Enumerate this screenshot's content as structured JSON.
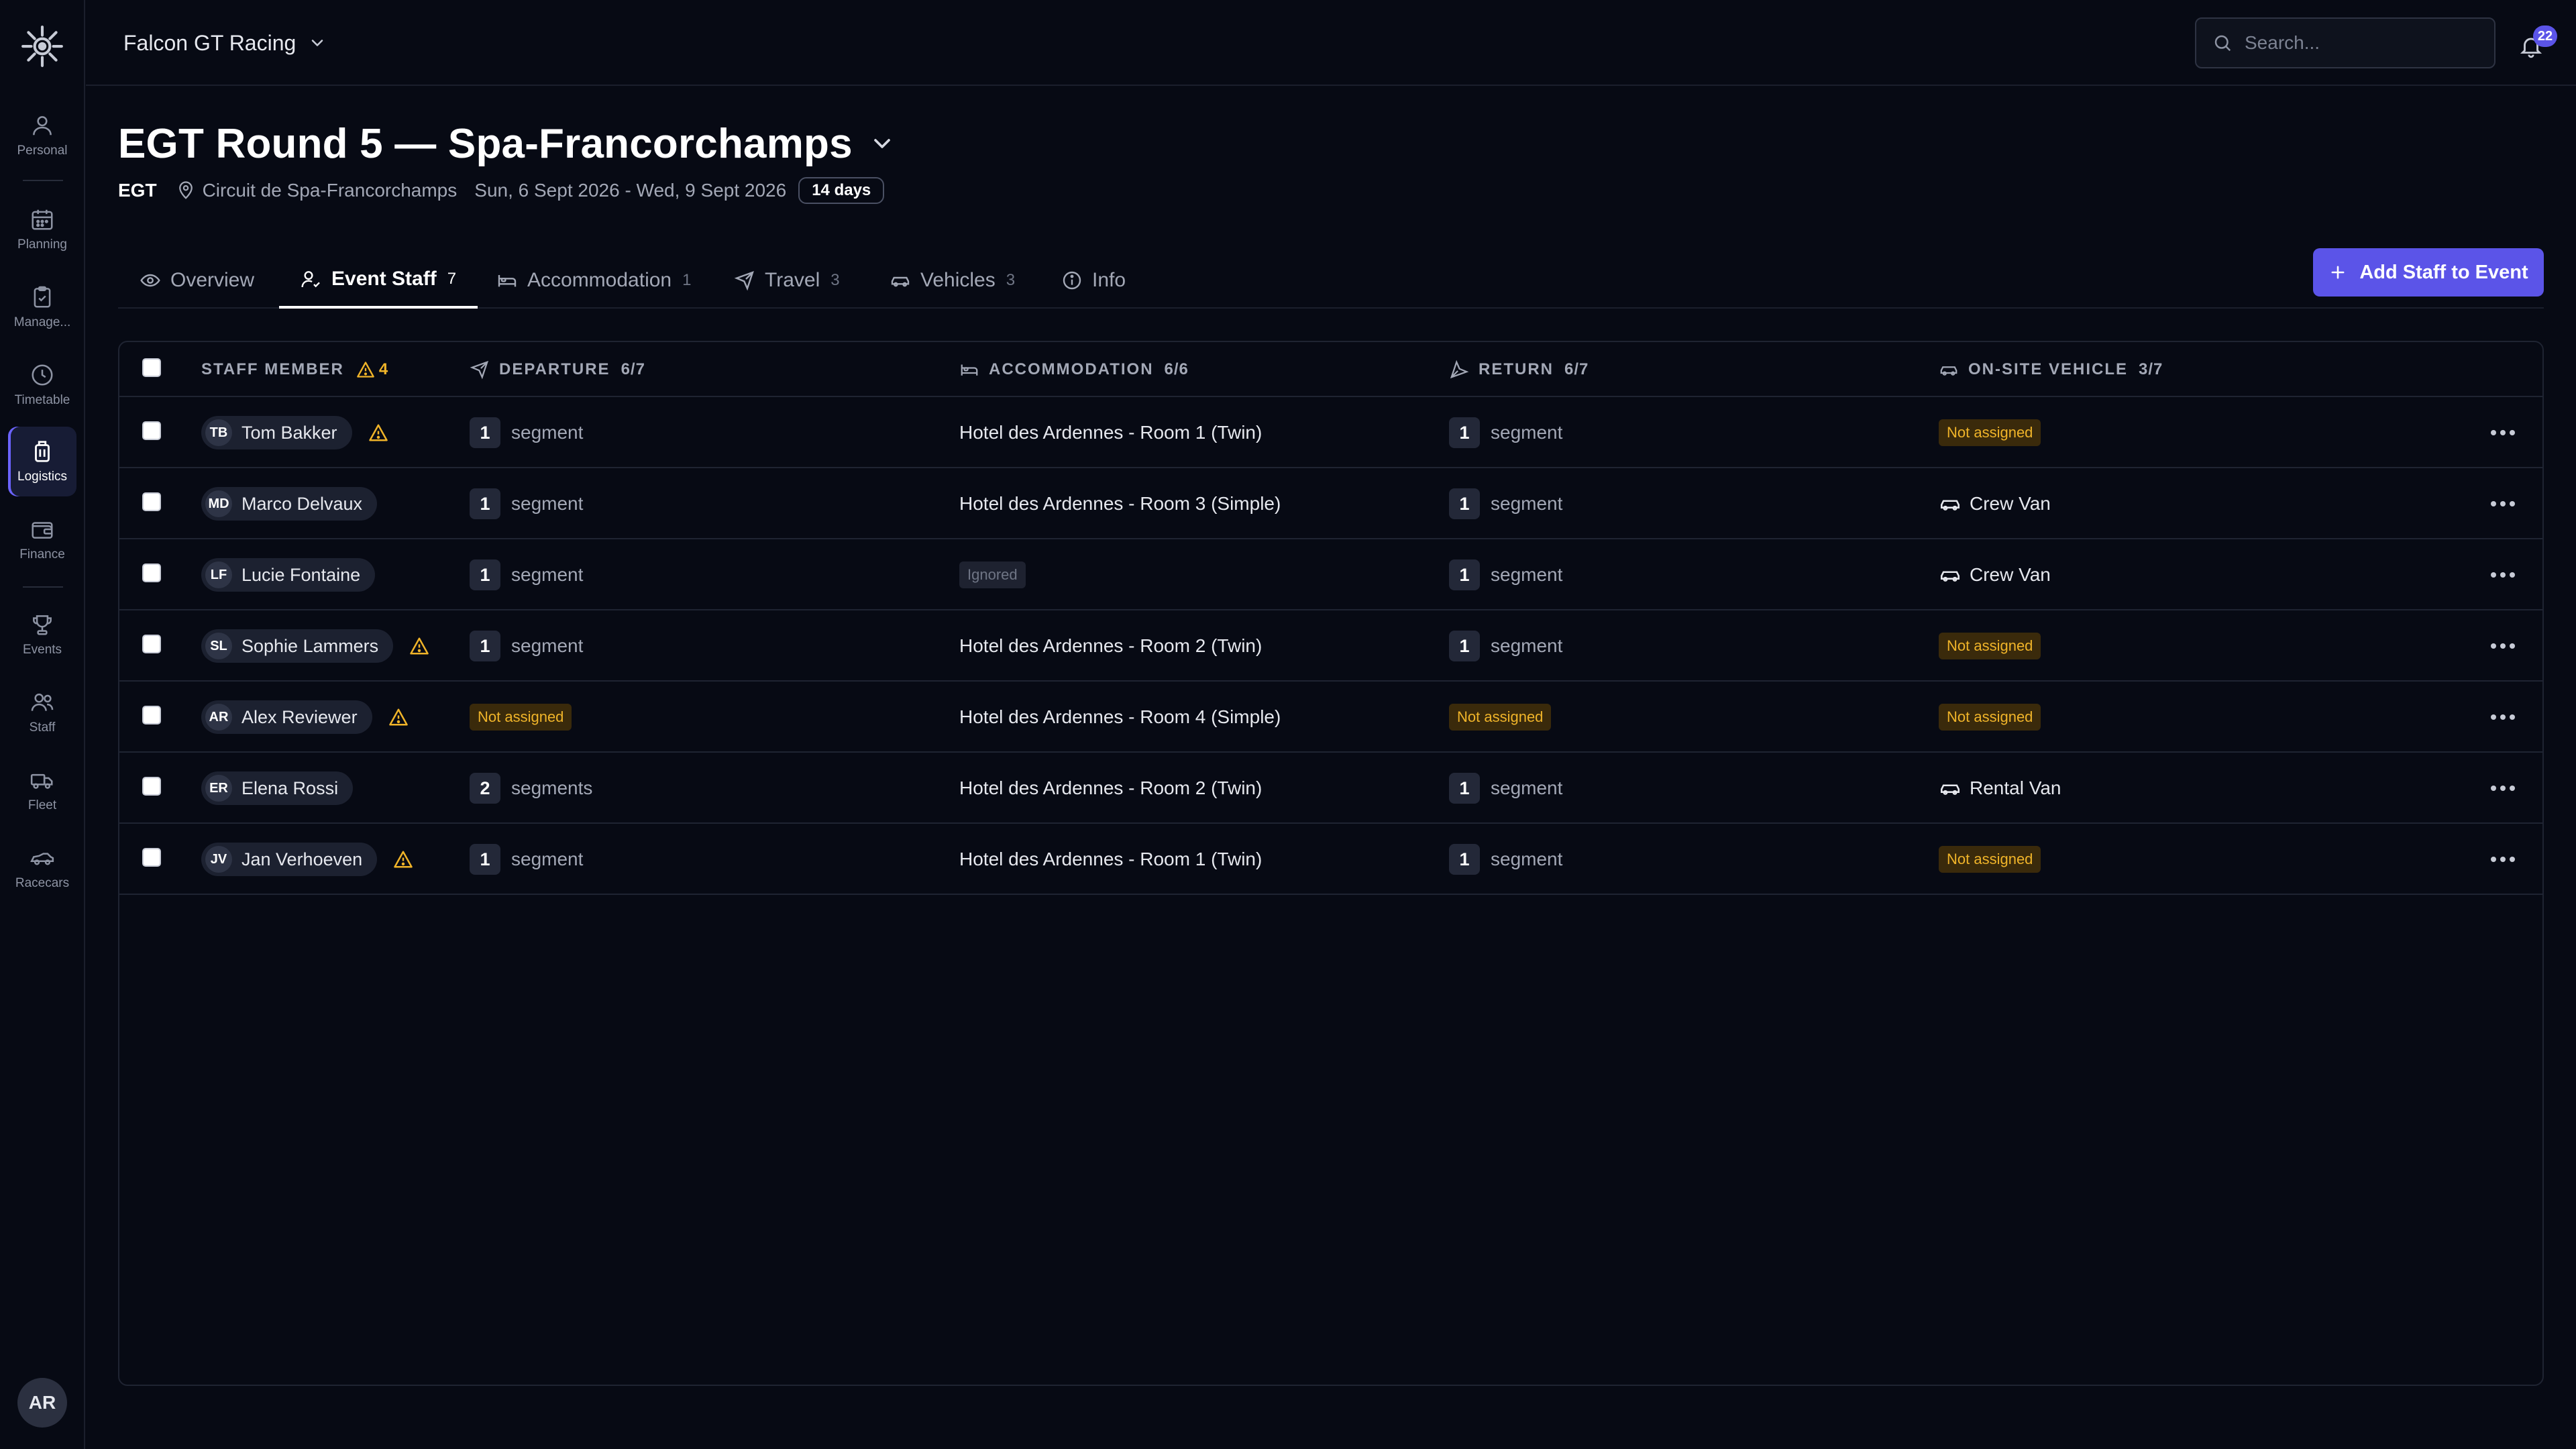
{
  "nav": {
    "items": [
      {
        "label": "Personal",
        "icon": "user-icon"
      },
      {
        "label": "Planning",
        "icon": "calendar-icon"
      },
      {
        "label": "Manage...",
        "icon": "clipboard-icon"
      },
      {
        "label": "Timetable",
        "icon": "clock-icon"
      },
      {
        "label": "Logistics",
        "icon": "luggage-icon",
        "active": true
      },
      {
        "label": "Finance",
        "icon": "wallet-icon"
      },
      {
        "label": "Events",
        "icon": "trophy-icon"
      },
      {
        "label": "Staff",
        "icon": "users-icon"
      },
      {
        "label": "Fleet",
        "icon": "truck-icon"
      },
      {
        "label": "Racecars",
        "icon": "car-icon"
      }
    ],
    "avatar_initials": "AR"
  },
  "topbar": {
    "org_name": "Falcon GT Racing",
    "search_placeholder": "Search...",
    "notification_count": "22"
  },
  "event": {
    "title": "EGT Round 5 — Spa-Francorchamps",
    "series": "EGT",
    "location": "Circuit de Spa-Francorchamps",
    "dates": "Sun, 6 Sept 2026 - Wed, 9 Sept 2026",
    "duration": "14 days"
  },
  "tabs": [
    {
      "label": "Overview",
      "count": ""
    },
    {
      "label": "Event Staff",
      "count": "7",
      "active": true
    },
    {
      "label": "Accommodation",
      "count": "1"
    },
    {
      "label": "Travel",
      "count": "3"
    },
    {
      "label": "Vehicles",
      "count": "3"
    },
    {
      "label": "Info",
      "count": ""
    }
  ],
  "actions": {
    "add_staff": "Add Staff to Event"
  },
  "table": {
    "columns": {
      "staff": {
        "label": "STAFF MEMBER",
        "warnings": "4"
      },
      "departure": {
        "label": "DEPARTURE",
        "count": "6/7"
      },
      "accommodation": {
        "label": "ACCOMMODATION",
        "count": "6/6"
      },
      "return": {
        "label": "RETURN",
        "count": "6/7"
      },
      "vehicle": {
        "label": "ON-SITE VEHICLE",
        "count": "3/7"
      }
    },
    "rows": [
      {
        "initials": "TB",
        "name": "Tom Bakker",
        "warning": true,
        "departure": {
          "num": "1",
          "text": "segment"
        },
        "accommodation": "Hotel des Ardennes - Room 1 (Twin)",
        "return": {
          "num": "1",
          "text": "segment"
        },
        "vehicle": "Not assigned"
      },
      {
        "initials": "MD",
        "name": "Marco Delvaux",
        "warning": false,
        "departure": {
          "num": "1",
          "text": "segment"
        },
        "accommodation": "Hotel des Ardennes - Room 3 (Simple)",
        "return": {
          "num": "1",
          "text": "segment"
        },
        "vehicle": "Crew Van"
      },
      {
        "initials": "LF",
        "name": "Lucie Fontaine",
        "warning": false,
        "departure": {
          "num": "1",
          "text": "segment"
        },
        "accommodation": "Ignored",
        "return": {
          "num": "1",
          "text": "segment"
        },
        "vehicle": "Crew Van"
      },
      {
        "initials": "SL",
        "name": "Sophie Lammers",
        "warning": true,
        "departure": {
          "num": "1",
          "text": "segment"
        },
        "accommodation": "Hotel des Ardennes - Room 2 (Twin)",
        "return": {
          "num": "1",
          "text": "segment"
        },
        "vehicle": "Not assigned"
      },
      {
        "initials": "AR",
        "name": "Alex Reviewer",
        "warning": true,
        "departure": "Not assigned",
        "accommodation": "Hotel des Ardennes - Room 4 (Simple)",
        "return": "Not assigned",
        "vehicle": "Not assigned"
      },
      {
        "initials": "ER",
        "name": "Elena Rossi",
        "warning": false,
        "departure": {
          "num": "2",
          "text": "segments"
        },
        "accommodation": "Hotel des Ardennes - Room 2 (Twin)",
        "return": {
          "num": "1",
          "text": "segment"
        },
        "vehicle": "Rental Van"
      },
      {
        "initials": "JV",
        "name": "Jan Verhoeven",
        "warning": true,
        "departure": {
          "num": "1",
          "text": "segment"
        },
        "accommodation": "Hotel des Ardennes - Room 1 (Twin)",
        "return": {
          "num": "1",
          "text": "segment"
        },
        "vehicle": "Not assigned"
      }
    ]
  },
  "colors": {
    "background": "#070a14",
    "accent": "#5b54e8",
    "warning": "#f0b429",
    "border": "#1f2432"
  }
}
